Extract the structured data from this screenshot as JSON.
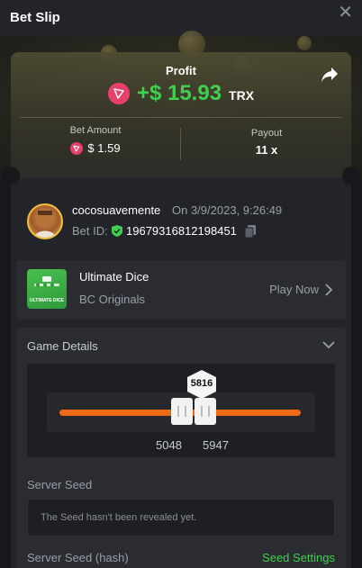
{
  "header": {
    "title": "Bet Slip",
    "close_icon": "close-icon"
  },
  "profit": {
    "label": "Profit",
    "value": "+$ 15.93",
    "currency": "TRX",
    "color": "#3fd04f",
    "coin_color": "#e83f6b"
  },
  "bet": {
    "amount_label": "Bet Amount",
    "amount_value": "$ 1.59",
    "payout_label": "Payout",
    "payout_value": "11 x"
  },
  "user": {
    "name": "cocosuavemente",
    "datetime": "On 3/9/2023, 9:26:49",
    "bet_id_label": "Bet ID:",
    "bet_id": "19679316812198451"
  },
  "game": {
    "name": "Ultimate Dice",
    "provider": "BC Originals",
    "play_label": "Play Now",
    "thumb_text": "ULTIMATE DICE"
  },
  "details": {
    "title": "Game Details",
    "result": "5816",
    "range_low": "5048",
    "range_high": "5947",
    "bar_color": "#ef6a14"
  },
  "seed": {
    "server_seed_label": "Server Seed",
    "server_seed_placeholder": "The Seed hasn't been revealed yet.",
    "server_seed_hash_label": "Server Seed (hash)",
    "seed_settings_label": "Seed Settings"
  }
}
